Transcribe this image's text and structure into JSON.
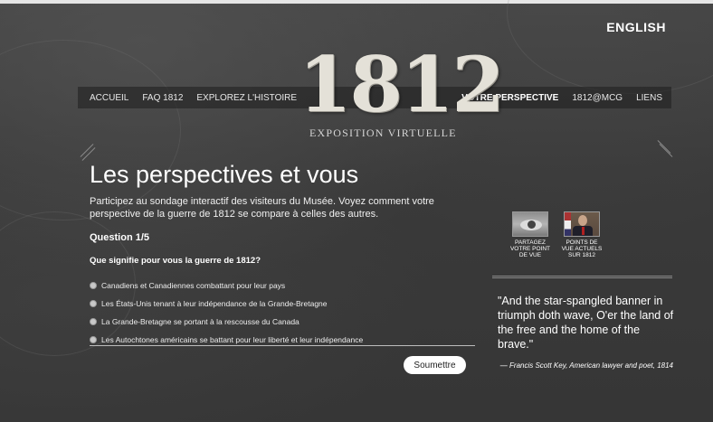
{
  "header": {
    "language_toggle": "ENGLISH",
    "logo_title": "1812",
    "logo_subtitle": "EXPOSITION VIRTUELLE"
  },
  "nav": {
    "left": [
      {
        "label": "ACCUEIL"
      },
      {
        "label": "FAQ 1812"
      },
      {
        "label": "EXPLOREZ L'HISTOIRE"
      }
    ],
    "right": [
      {
        "label": "VOTRE PERSPECTIVE",
        "active": true
      },
      {
        "label": "1812@MCG"
      },
      {
        "label": "LIENS"
      }
    ]
  },
  "main": {
    "title": "Les perspectives et vous",
    "intro": "Participez au sondage interactif des visiteurs du Musée. Voyez comment votre perspective de la guerre de 1812 se compare à celles des autres.",
    "question_number": "Question 1/5",
    "question_text": "Que signifie pour vous la guerre de 1812?",
    "options": [
      "Canadiens et Canadiennes combattant pour leur pays",
      "Les États-Unis tenant à leur indépendance de la Grande-Bretagne",
      "La Grande-Bretagne se portant à la rescousse du Canada",
      "Les Autochtones américains se battant pour leur liberté et leur indépendance"
    ],
    "submit_label": "Soumettre"
  },
  "sidebar": {
    "thumbs": [
      {
        "label": "PARTAGEZ VOTRE POINT DE VUE",
        "icon": "eye-icon"
      },
      {
        "label": "POINTS DE VUE ACTUELS SUR 1812",
        "icon": "portrait-icon"
      }
    ],
    "quote": "\"And the star-spangled banner in triumph doth wave, O'er the land of the free and the home of the brave.\"",
    "attribution": "— Francis Scott Key, American lawyer and poet, 1814"
  },
  "colors": {
    "background": "#3b3b3b",
    "text": "#ffffff",
    "logo": "#e4e1d8",
    "button_bg": "#ffffff"
  }
}
